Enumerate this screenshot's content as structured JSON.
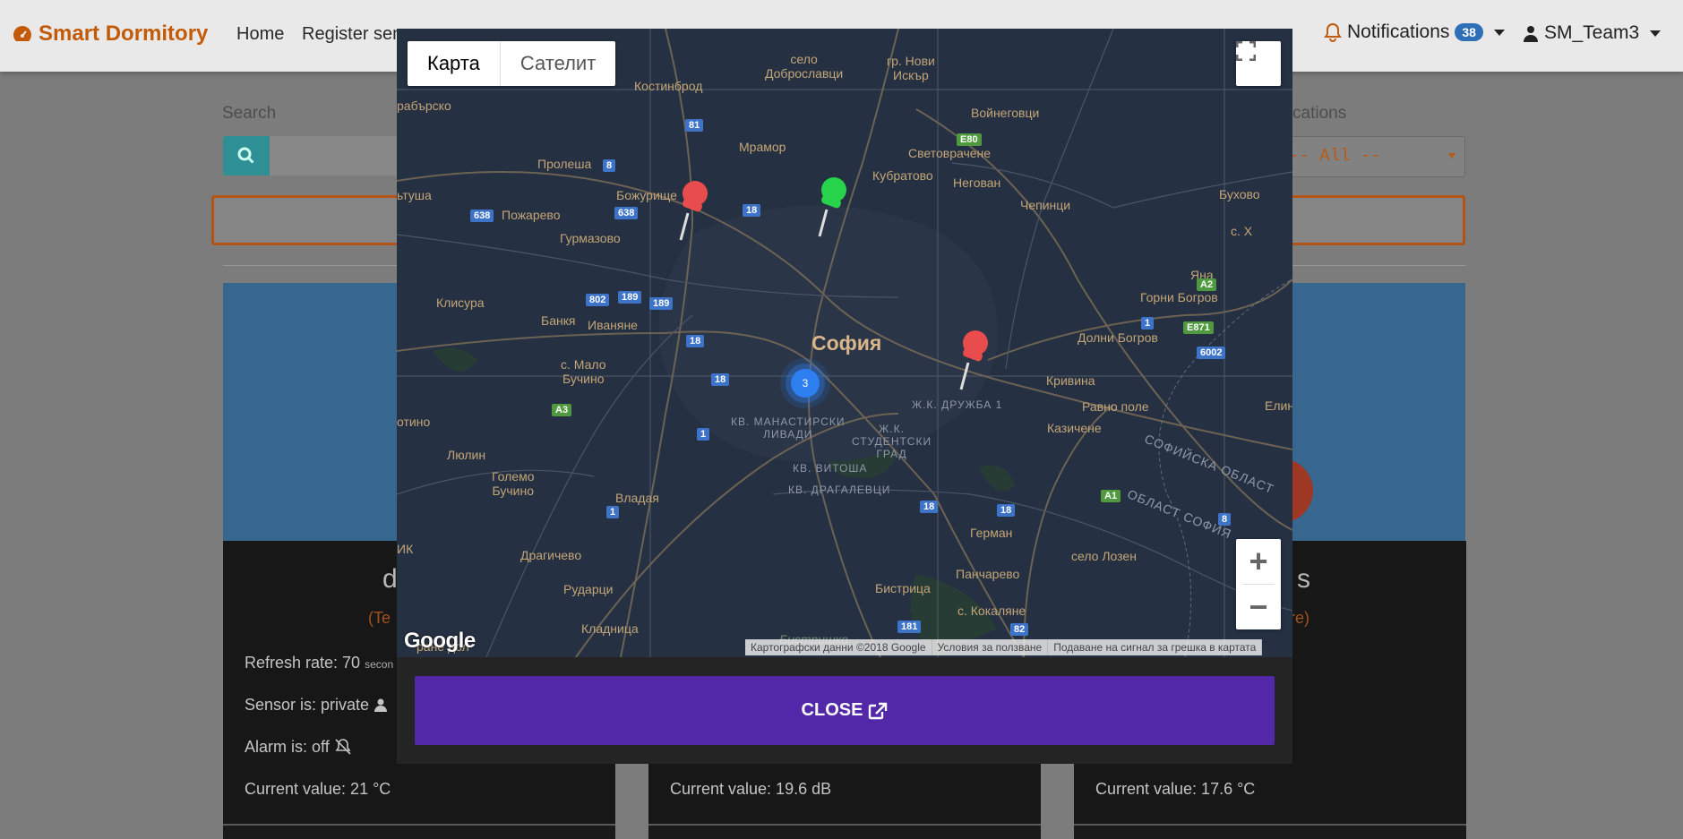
{
  "navbar": {
    "brand": "Smart Dormitory",
    "links": [
      "Home",
      "Register sen"
    ],
    "notifications_label": "Notifications",
    "notifications_count": "38",
    "username": "SM_Team3"
  },
  "toolbar": {
    "search_label": "Search",
    "notifications_filter_label": "tifications",
    "notifications_filter_value": "-- All --"
  },
  "cards": [
    {
      "title": "d",
      "subtitle": "(Te",
      "refresh_rate": "Refresh rate: 70",
      "refresh_unit": "secon",
      "privacy": "Sensor is: private",
      "alarm": "Alarm is: off",
      "current_value": "Current value: 21 °C"
    },
    {
      "current_value": "Current value: 19.6 dB"
    },
    {
      "title": "s",
      "subtitle": "ure)",
      "current_value": "Current value: 17.6 °C"
    }
  ],
  "map": {
    "type_map": "Карта",
    "type_satellite": "Сателит",
    "zoom_in": "+",
    "zoom_out": "−",
    "google": "Google",
    "attribution": [
      "Картографски данни ©2018 Google",
      "Условия за ползване",
      "Подаване на сигнал за грешка в картата"
    ],
    "cluster_count": "3",
    "pins": [
      {
        "color": "#e84c4c"
      },
      {
        "color": "#27d34a"
      },
      {
        "color": "#e84c4c"
      }
    ],
    "labels": {
      "sofia": "София",
      "selo_dobroslavtsi": "село\nДоброславци",
      "gr_novi_iskar": "гр. Нови\nИскър",
      "kostinbrod": "Костинброд",
      "voynegovtsi": "Войнеговци",
      "mramor": "Мрамор",
      "svetovrachene": "Световрачене",
      "kubratovo": "Кубратово",
      "negovan": "Негован",
      "chepintsi": "Чепинци",
      "buhovo": "Бухово",
      "proleshta": "Пролеша",
      "bozhurishte": "Божурище",
      "pozharevo": "Пожарево",
      "gurmazovo": "Гурмазово",
      "klisura": "Клисура",
      "bankya": "Банкя",
      "ivanyane": "Иваняне",
      "s_malo_buchino": "с. Мало\nБучино",
      "lyulin": "Люлин",
      "golemo_buchino": "Големо\nБучино",
      "vladaya": "Владая",
      "dragichevo": "Драгичево",
      "rudartsi": "Рударци",
      "kladnitsa": "Кладница",
      "bistritsa": "Бистрица",
      "s_kokalyane": "с. Кокаляне",
      "pancharevo": "Панчарево",
      "german": "Герман",
      "selo_lozen": "село Лозен",
      "kazichene": "Казичене",
      "ravno_pole": "Равно поле",
      "krivina": "Кривина",
      "dolni_bogrov": "Долни Богров",
      "gorni_bogrov": "Горни Богров",
      "yana": "Яна",
      "elin": "Елин",
      "s_h": "с. Х",
      "drujba": "Ж.К. ДРУЖБА 1",
      "manastirski": "КВ. МАНАСТИРСКИ\nЛИВАДИ",
      "studentski": "Ж.К.\nСТУДЕНТСКИ\nГРАД",
      "vitosha": "КВ. ВИТОША",
      "dragalevtsi": "КВ. ДРАГАЛЕВЦИ",
      "sofiyska_oblast": "СОФИЙСКА ОБЛАСТ",
      "oblast_sofia": "ОБЛАСТ СОФИЯ",
      "rabarsko": "рабърско",
      "stusha": "ьтуша",
      "otino": "отино",
      "ik": "ИК",
      "bistrishko": "Бистришко",
      "dol": "ране дол"
    },
    "shields": [
      "81",
      "8",
      "638",
      "638",
      "18",
      "E80",
      "802",
      "189",
      "189",
      "18",
      "18",
      "1",
      "A3",
      "A2",
      "1",
      "E871",
      "6002",
      "A1",
      "18",
      "18",
      "8",
      "181",
      "82",
      "1"
    ]
  },
  "modal": {
    "close_label": "CLOSE"
  }
}
